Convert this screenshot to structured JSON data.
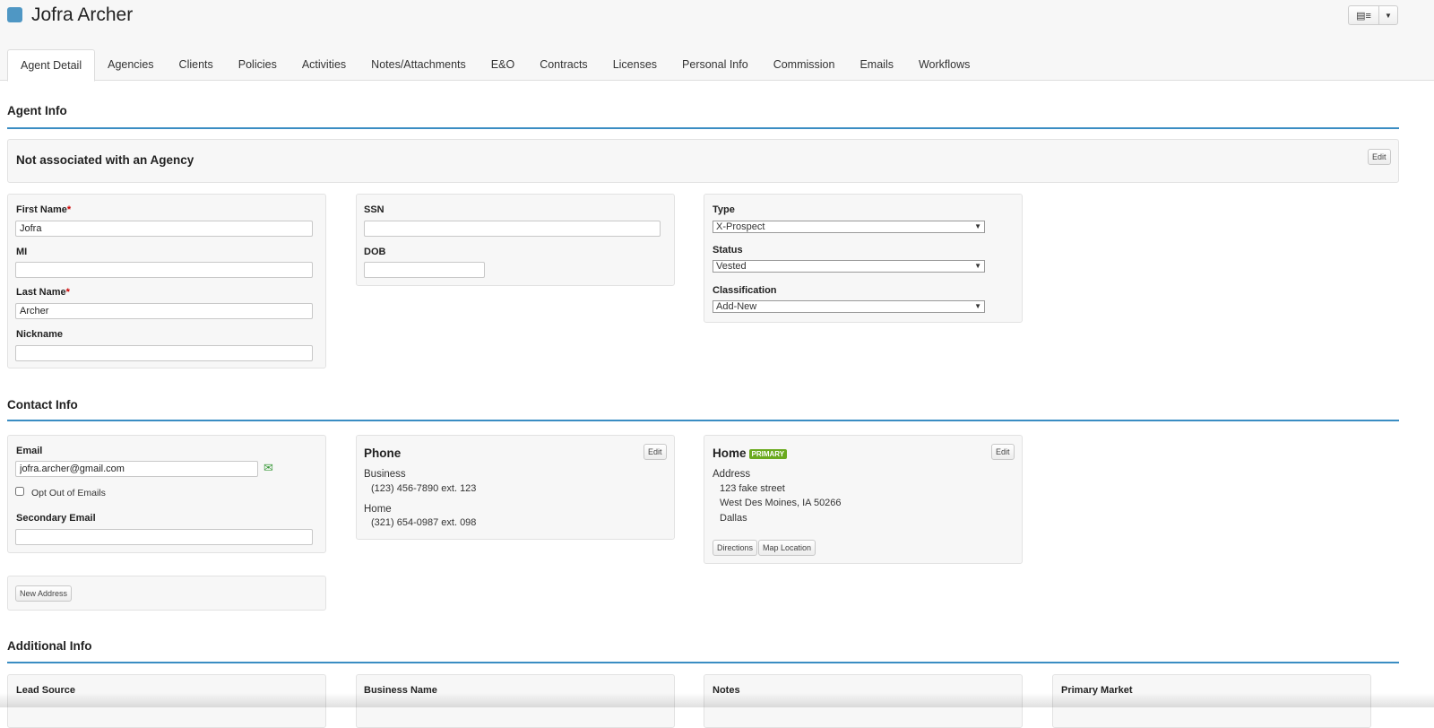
{
  "header": {
    "title": "Jofra Archer",
    "colors": {
      "accent": "#3a8dc3",
      "badge": "#6aaa1e"
    }
  },
  "tabs": [
    "Agent Detail",
    "Agencies",
    "Clients",
    "Policies",
    "Activities",
    "Notes/Attachments",
    "E&O",
    "Contracts",
    "Licenses",
    "Personal Info",
    "Commission",
    "Emails",
    "Workflows"
  ],
  "agent_info": {
    "heading": "Agent Info",
    "agency_text": "Not associated with an Agency",
    "edit": "Edit",
    "first_name_label": "First Name",
    "first_name": "Jofra",
    "mi_label": "MI",
    "mi": "",
    "last_name_label": "Last Name",
    "last_name": "Archer",
    "nickname_label": "Nickname",
    "nickname": "",
    "required_mark": "*",
    "ssn_label": "SSN",
    "ssn": "",
    "dob_label": "DOB",
    "dob": "",
    "type_label": "Type",
    "type": "X-Prospect",
    "status_label": "Status",
    "status": "Vested",
    "classification_label": "Classification",
    "classification": "Add-New"
  },
  "contact_info": {
    "heading": "Contact Info",
    "email_label": "Email",
    "email": "jofra.archer@gmail.com",
    "opt_out_label": "Opt Out of Emails",
    "secondary_email_label": "Secondary Email",
    "secondary_email": "",
    "new_address": "New Address",
    "phone": {
      "title": "Phone",
      "edit": "Edit",
      "business_label": "Business",
      "business": "(123) 456-7890 ext. 123",
      "home_label": "Home",
      "home": "(321) 654-0987 ext. 098"
    },
    "address": {
      "title": "Home",
      "badge": "PRIMARY",
      "edit": "Edit",
      "label": "Address",
      "line1": "123 fake street",
      "line2": "West Des Moines, IA 50266",
      "line3": "Dallas",
      "directions": "Directions",
      "map": "Map Location"
    }
  },
  "additional_info": {
    "heading": "Additional Info",
    "lead_source": "Lead Source",
    "business_name": "Business Name",
    "notes": "Notes",
    "primary_market": "Primary Market"
  }
}
